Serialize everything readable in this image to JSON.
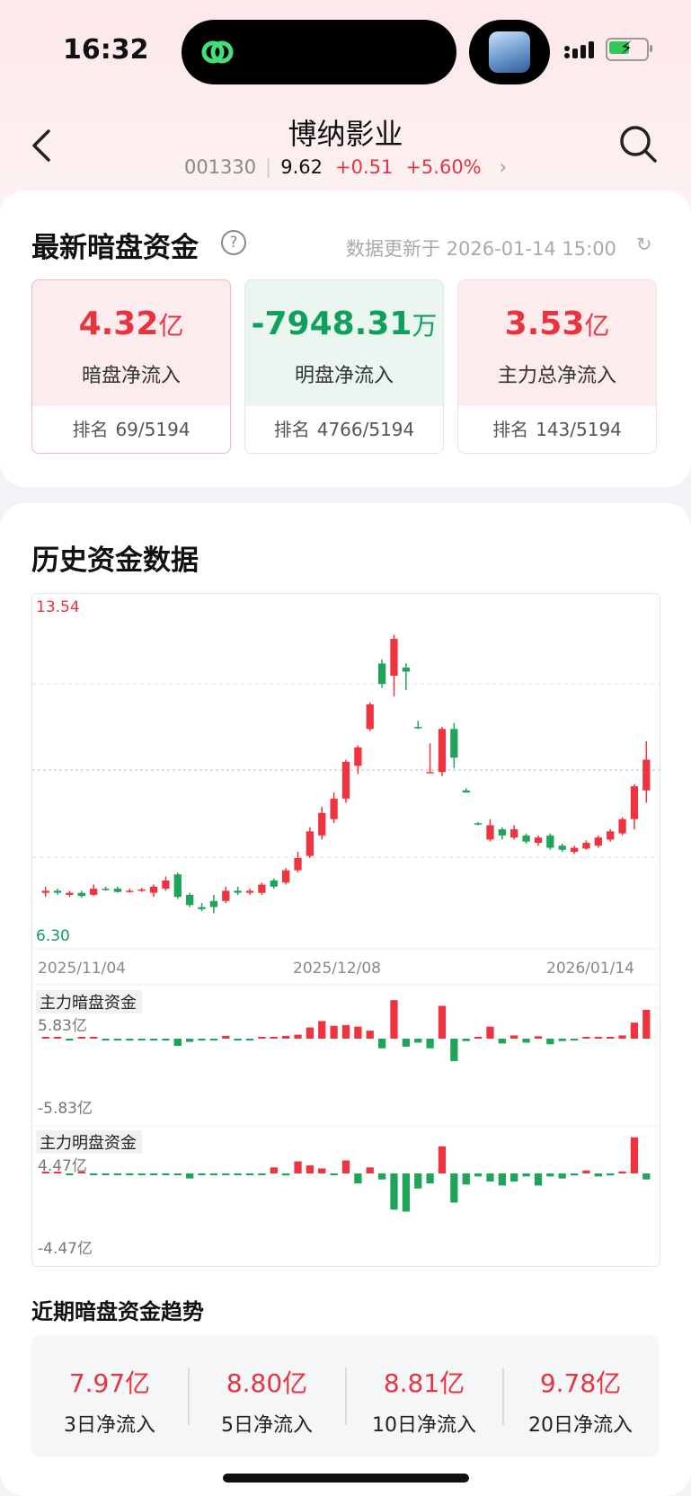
{
  "status": {
    "time": "16:32"
  },
  "stock": {
    "name": "博纳影业",
    "code": "001330",
    "price": "9.62",
    "change": "+0.51",
    "change_pct": "+5.60%"
  },
  "dark_pool": {
    "title": "最新暗盘资金",
    "update_text": "数据更新于 2026-01-14  15:00",
    "metrics": [
      {
        "value": "4.32",
        "unit": "亿",
        "label": "暗盘净流入",
        "rank_label": "排名",
        "rank": "69/5194",
        "color": "#e8343f"
      },
      {
        "value": "-7948.31",
        "unit": "万",
        "label": "明盘净流入",
        "rank_label": "排名",
        "rank": "4766/5194",
        "color": "#10a05c"
      },
      {
        "value": "3.53",
        "unit": "亿",
        "label": "主力总净流入",
        "rank_label": "排名",
        "rank": "143/5194",
        "color": "#e8343f"
      }
    ]
  },
  "history": {
    "title": "历史资金数据"
  },
  "chart_data": [
    {
      "type": "candlestick",
      "title": "",
      "ymax_label": "13.54",
      "ymin_label": "6.30",
      "ylim": [
        6.3,
        13.54
      ],
      "x_labels": [
        "2025/11/04",
        "2025/12/08",
        "2026/01/14"
      ],
      "up_color": "#f0343f",
      "down_color": "#1fa55a",
      "candles": [
        {
          "o": 6.9,
          "c": 6.95,
          "h": 7.05,
          "l": 6.8
        },
        {
          "o": 6.95,
          "c": 6.9,
          "h": 7.0,
          "l": 6.85
        },
        {
          "o": 6.85,
          "c": 6.9,
          "h": 6.95,
          "l": 6.8
        },
        {
          "o": 6.9,
          "c": 6.82,
          "h": 6.95,
          "l": 6.78
        },
        {
          "o": 6.85,
          "c": 7.0,
          "h": 7.1,
          "l": 6.82
        },
        {
          "o": 7.0,
          "c": 6.98,
          "h": 7.05,
          "l": 6.95
        },
        {
          "o": 7.0,
          "c": 6.92,
          "h": 7.05,
          "l": 6.9
        },
        {
          "o": 6.92,
          "c": 6.95,
          "h": 7.0,
          "l": 6.9
        },
        {
          "o": 6.95,
          "c": 6.98,
          "h": 7.02,
          "l": 6.92
        },
        {
          "o": 6.9,
          "c": 7.05,
          "h": 7.1,
          "l": 6.8
        },
        {
          "o": 7.0,
          "c": 7.2,
          "h": 7.3,
          "l": 6.95
        },
        {
          "o": 7.35,
          "c": 6.8,
          "h": 7.4,
          "l": 6.75
        },
        {
          "o": 6.85,
          "c": 6.6,
          "h": 6.9,
          "l": 6.55
        },
        {
          "o": 6.55,
          "c": 6.5,
          "h": 6.65,
          "l": 6.45
        },
        {
          "o": 6.7,
          "c": 6.55,
          "h": 6.85,
          "l": 6.4
        },
        {
          "o": 6.7,
          "c": 6.95,
          "h": 7.05,
          "l": 6.65
        },
        {
          "o": 6.95,
          "c": 6.9,
          "h": 7.05,
          "l": 6.85
        },
        {
          "o": 6.9,
          "c": 6.95,
          "h": 7.0,
          "l": 6.85
        },
        {
          "o": 6.9,
          "c": 7.1,
          "h": 7.15,
          "l": 6.85
        },
        {
          "o": 7.2,
          "c": 7.05,
          "h": 7.25,
          "l": 7.0
        },
        {
          "o": 7.15,
          "c": 7.45,
          "h": 7.5,
          "l": 7.1
        },
        {
          "o": 7.45,
          "c": 7.75,
          "h": 7.9,
          "l": 7.4
        },
        {
          "o": 7.8,
          "c": 8.4,
          "h": 8.5,
          "l": 7.75
        },
        {
          "o": 8.3,
          "c": 8.85,
          "h": 9.0,
          "l": 8.2
        },
        {
          "o": 8.7,
          "c": 9.2,
          "h": 9.35,
          "l": 8.6
        },
        {
          "o": 9.2,
          "c": 10.1,
          "h": 10.15,
          "l": 9.1
        },
        {
          "o": 10.0,
          "c": 10.45,
          "h": 10.5,
          "l": 9.8
        },
        {
          "o": 10.9,
          "c": 11.5,
          "h": 11.55,
          "l": 10.85
        },
        {
          "o": 12.5,
          "c": 12.0,
          "h": 12.6,
          "l": 11.9
        },
        {
          "o": 12.2,
          "c": 13.1,
          "h": 13.2,
          "l": 11.7
        },
        {
          "o": 12.4,
          "c": 12.3,
          "h": 12.5,
          "l": 11.85
        },
        {
          "o": 10.95,
          "c": 10.92,
          "h": 11.1,
          "l": 10.9
        },
        {
          "o": 9.85,
          "c": 9.85,
          "h": 10.55,
          "l": 9.85
        },
        {
          "o": 9.85,
          "c": 10.9,
          "h": 10.95,
          "l": 9.75
        },
        {
          "o": 10.9,
          "c": 10.2,
          "h": 11.05,
          "l": 9.95
        },
        {
          "o": 9.4,
          "c": 9.35,
          "h": 9.45,
          "l": 9.35
        },
        {
          "o": 8.6,
          "c": 8.58,
          "h": 8.62,
          "l": 8.55
        },
        {
          "o": 8.2,
          "c": 8.55,
          "h": 8.7,
          "l": 8.15
        },
        {
          "o": 8.45,
          "c": 8.3,
          "h": 8.5,
          "l": 8.2
        },
        {
          "o": 8.25,
          "c": 8.45,
          "h": 8.55,
          "l": 8.2
        },
        {
          "o": 8.3,
          "c": 8.15,
          "h": 8.35,
          "l": 8.1
        },
        {
          "o": 8.12,
          "c": 8.25,
          "h": 8.3,
          "l": 8.05
        },
        {
          "o": 8.3,
          "c": 8.0,
          "h": 8.35,
          "l": 7.95
        },
        {
          "o": 8.05,
          "c": 7.95,
          "h": 8.1,
          "l": 7.9
        },
        {
          "o": 7.9,
          "c": 8.0,
          "h": 8.05,
          "l": 7.85
        },
        {
          "o": 7.98,
          "c": 8.12,
          "h": 8.18,
          "l": 7.95
        },
        {
          "o": 8.05,
          "c": 8.25,
          "h": 8.3,
          "l": 8.0
        },
        {
          "o": 8.2,
          "c": 8.4,
          "h": 8.45,
          "l": 8.15
        },
        {
          "o": 8.35,
          "c": 8.7,
          "h": 8.75,
          "l": 8.3
        },
        {
          "o": 8.7,
          "c": 9.5,
          "h": 9.55,
          "l": 8.45
        },
        {
          "o": 9.4,
          "c": 10.15,
          "h": 10.6,
          "l": 9.1
        }
      ]
    },
    {
      "type": "bar",
      "title": "主力暗盘资金",
      "ymax_label": "5.83亿",
      "ymin_label": "-5.83亿",
      "ylim": [
        -5.83,
        5.83
      ],
      "values": [
        0.12,
        0.05,
        -0.06,
        0.18,
        0.08,
        -0.05,
        -0.06,
        -0.05,
        -0.04,
        -0.05,
        -0.06,
        -0.9,
        -0.4,
        -0.1,
        -0.08,
        0.35,
        -0.05,
        -0.08,
        0.08,
        0.12,
        0.35,
        0.5,
        1.4,
        2.2,
        1.6,
        1.7,
        1.5,
        1.0,
        -1.2,
        4.8,
        -1.0,
        -0.5,
        -1.2,
        4.1,
        -2.8,
        -0.3,
        0.2,
        1.5,
        -0.6,
        0.4,
        -0.5,
        0.3,
        -0.7,
        -0.3,
        -0.2,
        0.12,
        0.2,
        0.2,
        0.4,
        2.0,
        3.6
      ]
    },
    {
      "type": "bar",
      "title": "主力明盘资金",
      "ymax_label": "4.47亿",
      "ymin_label": "-4.47亿",
      "ylim": [
        -4.47,
        4.47
      ],
      "values": [
        0.1,
        0.05,
        -0.05,
        0.1,
        -0.05,
        -0.05,
        -0.05,
        -0.05,
        -0.05,
        -0.05,
        -0.05,
        -0.08,
        -0.5,
        -0.1,
        -0.05,
        -0.05,
        -0.05,
        -0.05,
        -0.05,
        0.6,
        -0.2,
        1.2,
        0.8,
        0.5,
        -0.1,
        1.3,
        -1.0,
        0.6,
        -0.6,
        -3.6,
        -3.8,
        -1.5,
        -1.0,
        2.7,
        -2.9,
        -1.1,
        -0.3,
        -0.8,
        -1.2,
        -0.8,
        -0.3,
        -1.2,
        -0.3,
        -0.5,
        -0.2,
        0.3,
        -0.3,
        -0.2,
        0.2,
        3.6,
        -0.6
      ]
    }
  ],
  "trend": {
    "title": "近期暗盘资金趋势",
    "items": [
      {
        "value": "7.97亿",
        "label": "3日净流入"
      },
      {
        "value": "8.80亿",
        "label": "5日净流入"
      },
      {
        "value": "8.81亿",
        "label": "10日净流入"
      },
      {
        "value": "9.78亿",
        "label": "20日净流入"
      }
    ]
  }
}
